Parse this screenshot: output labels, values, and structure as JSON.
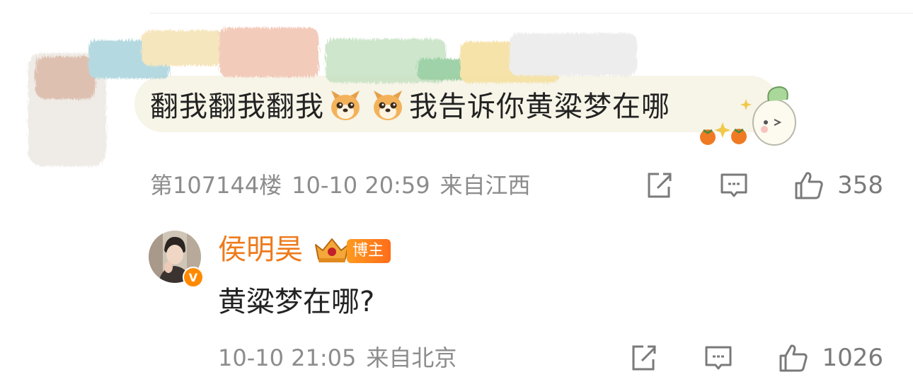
{
  "comment": {
    "text_before": "翻我翻我翻我",
    "emoji": "dog-face-emoji",
    "text_after": "我告诉你黄粱梦在哪",
    "floor": "第107144楼",
    "time": "10-10 20:59",
    "location": "来自江西",
    "likes": "358"
  },
  "reply": {
    "username": "侯明昊",
    "badge_label": "博主",
    "verified_mark": "V",
    "text": "黄粱梦在哪?",
    "time": "10-10 21:05",
    "location": "来自北京",
    "likes": "1026"
  },
  "colors": {
    "username": "#ee7a1b",
    "meta_text": "#8c8c8c",
    "body_text": "#222222",
    "badge": "#ff7a1a"
  },
  "icons": [
    "share-icon",
    "comment-icon",
    "thumbs-up-icon",
    "crown-badge-icon",
    "verified-icon"
  ]
}
